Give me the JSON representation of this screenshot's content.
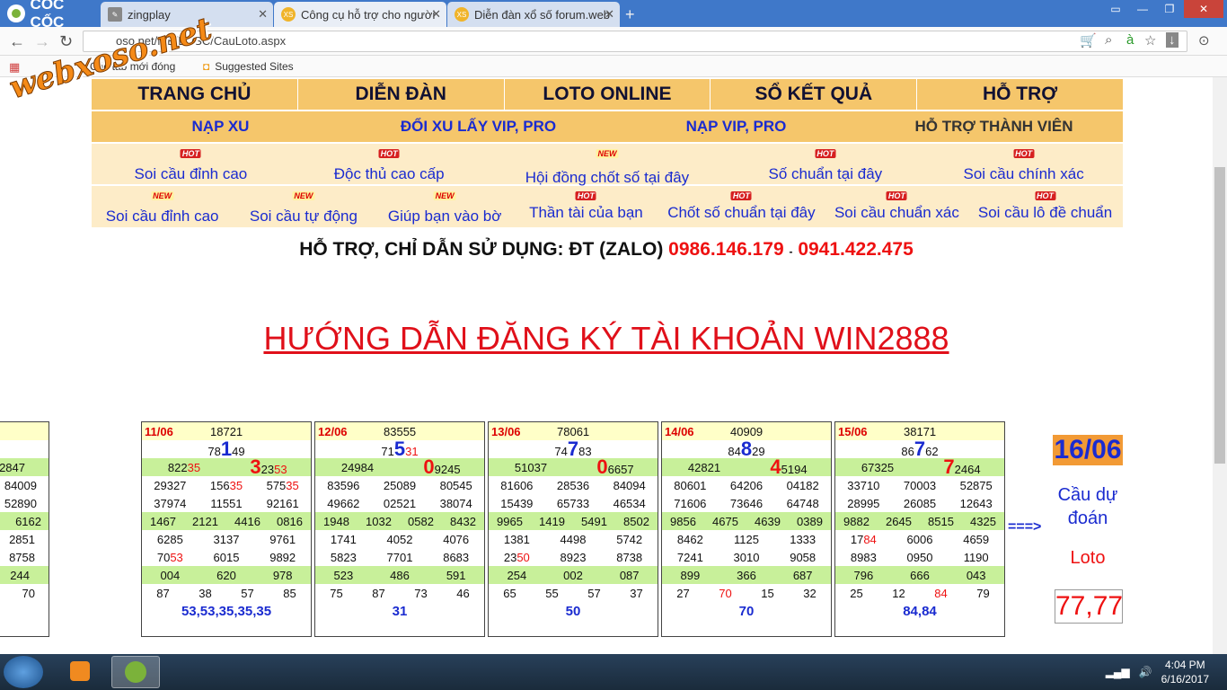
{
  "browser": {
    "brand": "CỐC CỐC",
    "tabs": [
      {
        "label": "zingplay"
      },
      {
        "label": "Công cụ hỗ trợ cho người"
      },
      {
        "label": "Diễn đàn xổ số forum.web"
      }
    ],
    "url": "webxoso.net/MB/LT/SC/CauLoto.aspx",
    "url_shown": "oso.net/MB/LT/SC/CauLoto.aspx",
    "bookmarks": [
      {
        "label": "Các tab mới đóng"
      },
      {
        "label": "Suggested Sites"
      }
    ]
  },
  "watermark": "webxoso.net",
  "menu_main": [
    {
      "label": "TRANG CHỦ"
    },
    {
      "label": "DIỄN ĐÀN"
    },
    {
      "label": "LOTO ONLINE"
    },
    {
      "label": "SỔ KẾT QUẢ"
    },
    {
      "label": "HỖ TRỢ"
    }
  ],
  "menu_sub": [
    {
      "label": "NẠP XU"
    },
    {
      "label": "ĐỔI XU LẤY VIP, PRO"
    },
    {
      "label": "NẠP VIP, PRO"
    },
    {
      "label": "HỖ TRỢ THÀNH VIÊN"
    }
  ],
  "links_row1": [
    {
      "label": "Soi cầu đỉnh cao",
      "badge": "HOT"
    },
    {
      "label": "Độc thủ cao cấp",
      "badge": "HOT"
    },
    {
      "label": "Hội đồng chốt số tại đây",
      "badge": "NEW"
    },
    {
      "label": "Số chuẩn tại đây",
      "badge": "HOT"
    },
    {
      "label": "Soi cầu chính xác",
      "badge": "HOT"
    }
  ],
  "links_row2": [
    {
      "label": "Soi cầu đỉnh cao",
      "badge": "NEW"
    },
    {
      "label": "Soi cầu tự động",
      "badge": "NEW"
    },
    {
      "label": "Giúp bạn vào bờ",
      "badge": "NEW"
    },
    {
      "label": "Thần tài của bạn",
      "badge": "HOT"
    },
    {
      "label": "Chốt số chuẩn tại đây",
      "badge": "HOT"
    },
    {
      "label": "Soi cầu chuẩn xác",
      "badge": "HOT"
    },
    {
      "label": "Soi cầu lô đề chuẩn",
      "badge": "HOT"
    }
  ],
  "support": {
    "text": "HỖ TRỢ, CHỈ DẪN SỬ DỤNG: ĐT (ZALO)",
    "phone1": "0986.146.179",
    "sep": "-",
    "phone2": "0941.422.475"
  },
  "headline": "HƯỚNG DẪN ĐĂNG KÝ TÀI KHOẢN WIN2888",
  "partial_box": {
    "rows": [
      "",
      "",
      "2847",
      "84009",
      "52890",
      "6162",
      "2851",
      "8758",
      "244",
      "70",
      ""
    ]
  },
  "boxes": [
    {
      "date": "11/06",
      "top": "18721",
      "special": "78149",
      "g1": "82235",
      "g1big": "3",
      "g1rest": "2353",
      "g2": [
        "29327",
        "15635",
        "57535"
      ],
      "g3": [
        "37974",
        "11551",
        "92161"
      ],
      "g4": [
        "1467",
        "2121",
        "4416",
        "0816"
      ],
      "g5": [
        "6285",
        "3137",
        "9761"
      ],
      "g6": [
        "7053",
        "6015",
        "9892"
      ],
      "g7": [
        "004",
        "620",
        "978"
      ],
      "g8": [
        "87",
        "38",
        "57",
        "85"
      ],
      "result": "53,53,35,35,35"
    },
    {
      "date": "12/06",
      "top": "83555",
      "special": "71531",
      "g1": "24984",
      "g1big": "0",
      "g1rest": "9245",
      "g2": [
        "83596",
        "25089",
        "80545"
      ],
      "g3": [
        "49662",
        "02521",
        "38074"
      ],
      "g4": [
        "1948",
        "1032",
        "0582",
        "8432"
      ],
      "g5": [
        "1741",
        "4052",
        "4076"
      ],
      "g6": [
        "5823",
        "7701",
        "8683"
      ],
      "g7": [
        "523",
        "486",
        "591"
      ],
      "g8": [
        "75",
        "87",
        "73",
        "46"
      ],
      "result": "31"
    },
    {
      "date": "13/06",
      "top": "78061",
      "special": "74783",
      "g1": "51037",
      "g1big": "0",
      "g1rest": "6657",
      "g2": [
        "81606",
        "28536",
        "84094"
      ],
      "g3": [
        "15439",
        "65733",
        "46534"
      ],
      "g4": [
        "9965",
        "1419",
        "5491",
        "8502"
      ],
      "g5": [
        "1381",
        "4498",
        "5742"
      ],
      "g6": [
        "2350",
        "8923",
        "8738"
      ],
      "g7": [
        "254",
        "002",
        "087"
      ],
      "g8": [
        "65",
        "55",
        "57",
        "37"
      ],
      "result": "50"
    },
    {
      "date": "14/06",
      "top": "40909",
      "special": "84829",
      "g1": "42821",
      "g1big": "4",
      "g1rest": "5194",
      "g2": [
        "80601",
        "64206",
        "04182"
      ],
      "g3": [
        "71606",
        "73646",
        "64748"
      ],
      "g4": [
        "9856",
        "4675",
        "4639",
        "0389"
      ],
      "g5": [
        "8462",
        "1125",
        "1333"
      ],
      "g6": [
        "7241",
        "3010",
        "9058"
      ],
      "g7": [
        "899",
        "366",
        "687"
      ],
      "g8": [
        "27",
        "70",
        "15",
        "32"
      ],
      "result": "70"
    },
    {
      "date": "15/06",
      "top": "38171",
      "special": "86762",
      "g1": "67325",
      "g1big": "7",
      "g1rest": "2464",
      "g2": [
        "33710",
        "70003",
        "52875"
      ],
      "g3": [
        "28995",
        "26085",
        "12643"
      ],
      "g4": [
        "9882",
        "2645",
        "8515",
        "4325"
      ],
      "g5": [
        "1784",
        "6006",
        "4659"
      ],
      "g6": [
        "8983",
        "0950",
        "1190"
      ],
      "g7": [
        "796",
        "666",
        "043"
      ],
      "g8": [
        "25",
        "12",
        "84",
        "79"
      ],
      "result": "84,84"
    }
  ],
  "prediction": {
    "arrow": "===>",
    "date": "16/06",
    "label1": "Cầu dự đoán",
    "label2": "Loto",
    "value": "77,77"
  },
  "taskbar": {
    "time": "4:04 PM",
    "date": "6/16/2017"
  }
}
